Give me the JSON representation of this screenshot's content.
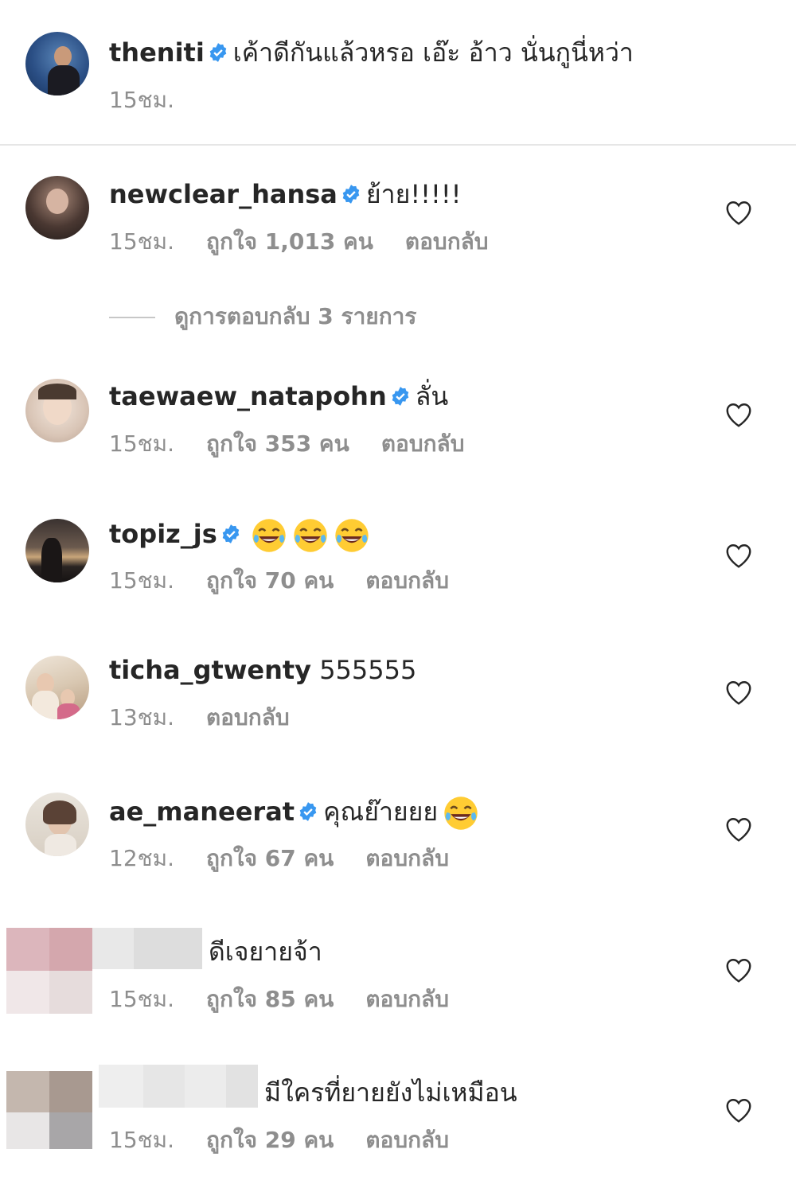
{
  "caption": {
    "username": "theniti",
    "verified": true,
    "text": "เค้าดีกันแล้วหรอ เอ๊ะ อ้าว นั่นกูนี่หว่า",
    "time": "15ชม."
  },
  "view_replies": "ดูการตอบกลับ 3 รายการ",
  "comments": [
    {
      "username": "newclear_hansa",
      "verified": true,
      "text": "ย้าย!!!!!",
      "time": "15ชม.",
      "likes": "ถูกใจ 1,013 คน",
      "reply": "ตอบกลับ"
    },
    {
      "username": "taewaew_natapohn",
      "verified": true,
      "text": "ลั่น",
      "time": "15ชม.",
      "likes": "ถูกใจ 353 คน",
      "reply": "ตอบกลับ"
    },
    {
      "username": "topiz_js",
      "verified": true,
      "text": "",
      "emoji": [
        "face-with-tears-of-joy",
        "face-with-tears-of-joy",
        "face-with-tears-of-joy"
      ],
      "time": "15ชม.",
      "likes": "ถูกใจ 70 คน",
      "reply": "ตอบกลับ"
    },
    {
      "username": "ticha_gtwenty",
      "verified": false,
      "text": "555555",
      "time": "13ชม.",
      "reply": "ตอบกลับ"
    },
    {
      "username": "ae_maneerat",
      "verified": true,
      "text": "คุณย๊ายยย",
      "emoji": [
        "face-with-tears-of-joy"
      ],
      "time": "12ชม.",
      "likes": "ถูกใจ 67 คน",
      "reply": "ตอบกลับ"
    },
    {
      "username": "",
      "verified": false,
      "text": "ดีเจยายจ้า",
      "time": "15ชม.",
      "likes": "ถูกใจ 85 คน",
      "reply": "ตอบกลับ"
    },
    {
      "username": "",
      "verified": false,
      "text": "มีใครที่ยายยังไม่เหมือน",
      "time": "15ชม.",
      "likes": "ถูกใจ 29 คน",
      "reply": "ตอบกลับ"
    }
  ],
  "colors": {
    "verified": "#3897f0",
    "muted": "#8e8e8e",
    "text": "#262626"
  },
  "icons": {
    "like": "heart-outline-icon",
    "verified": "verified-badge-icon"
  }
}
